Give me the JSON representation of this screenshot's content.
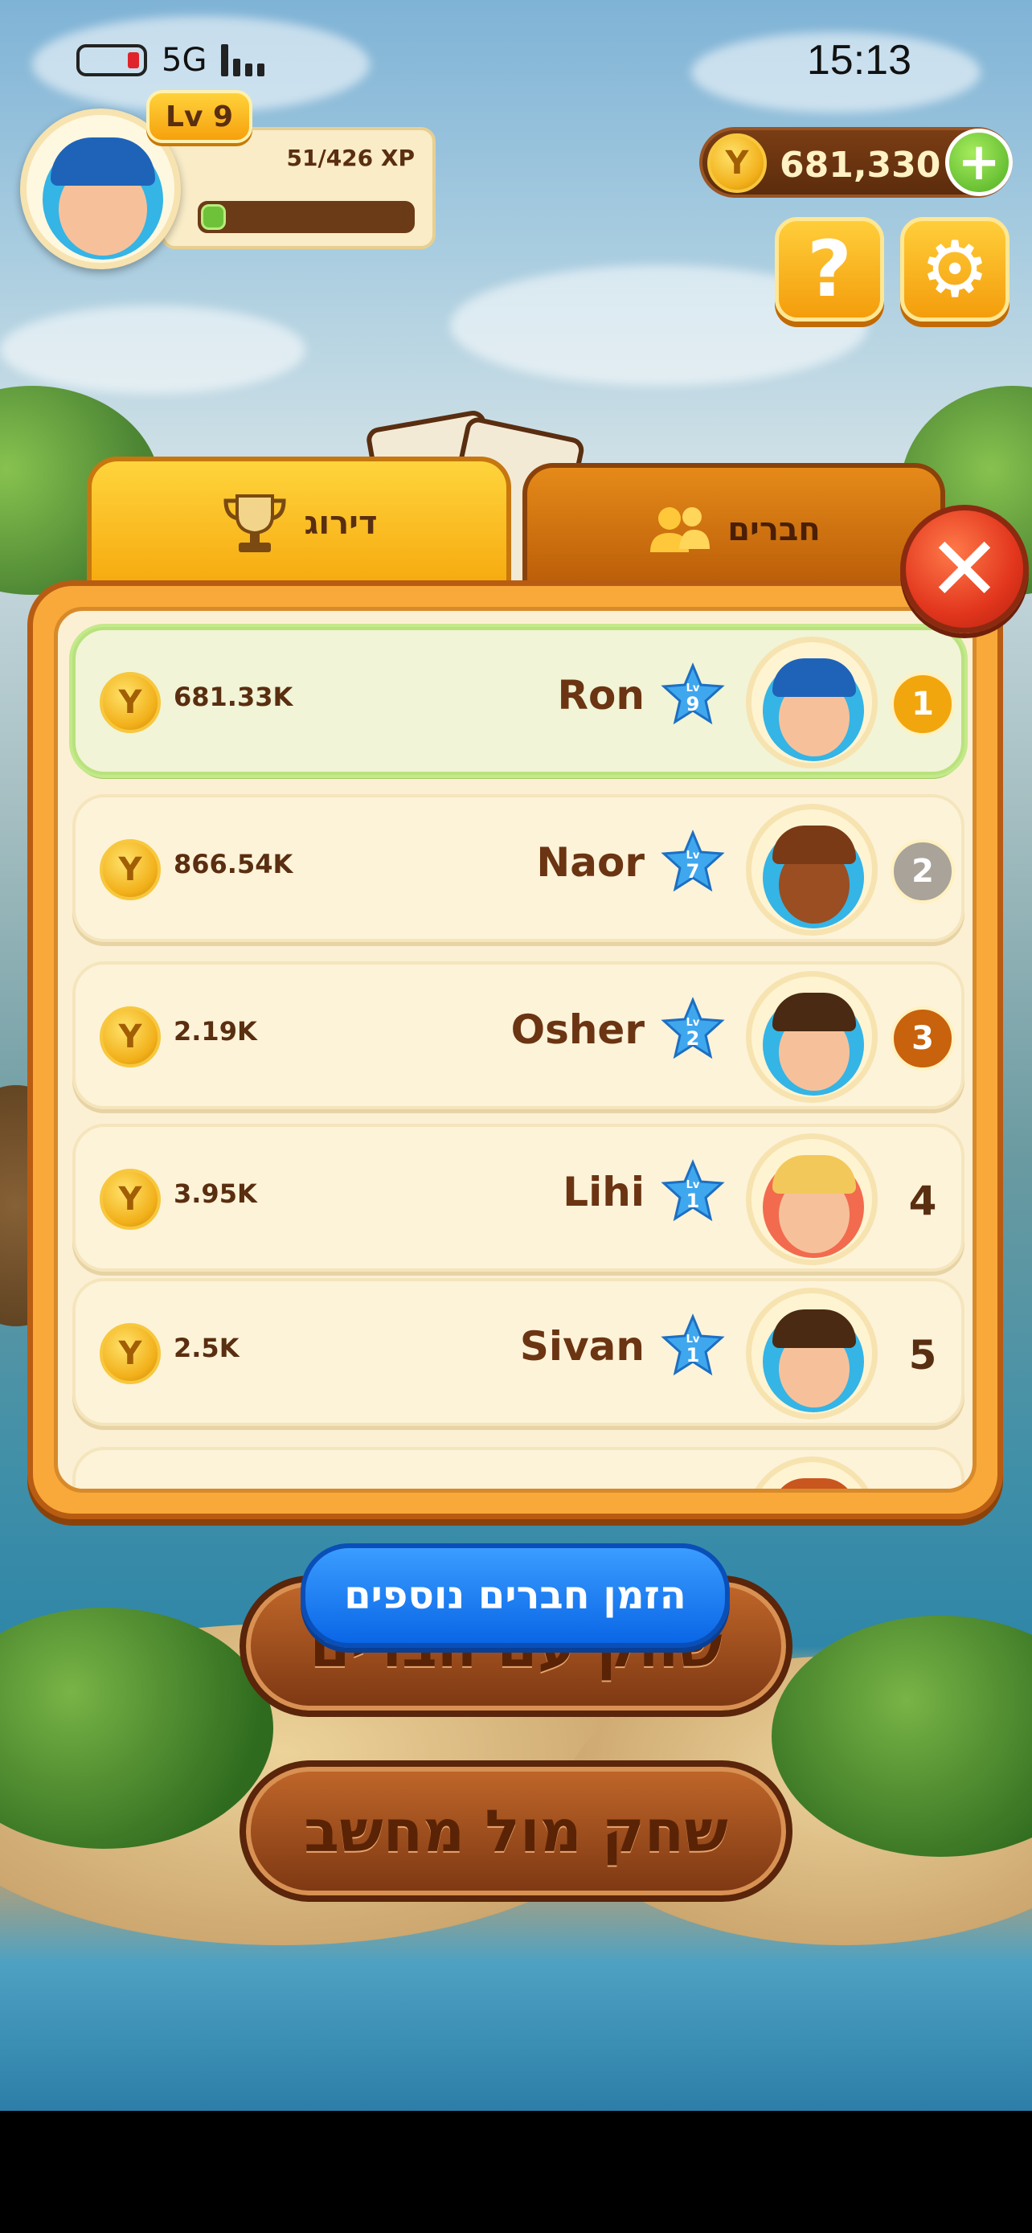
{
  "status_bar": {
    "network": "5G",
    "time": "15:13"
  },
  "profile": {
    "level_label": "Lv 9",
    "xp_text": "51/426 XP",
    "xp_progress": 0.12
  },
  "currency": {
    "coin_glyph": "Y",
    "amount": "681,330",
    "add_label": "+"
  },
  "top_buttons": {
    "help_label": "?",
    "settings_label": "⚙"
  },
  "tabs": [
    {
      "label": "דירוג",
      "icon": "trophy-icon",
      "active": true
    },
    {
      "label": "חברים",
      "icon": "friends-icon",
      "active": false
    }
  ],
  "close_label": "✕",
  "leaderboard": [
    {
      "rank": "1",
      "name": "Ron",
      "level": "9",
      "score": "681.33K",
      "avatar": "boy-cap",
      "highlight": true,
      "medal": "gold"
    },
    {
      "rank": "2",
      "name": "Naor",
      "level": "7",
      "score": "866.54K",
      "avatar": "walrus",
      "highlight": false,
      "medal": "silver"
    },
    {
      "rank": "3",
      "name": "Osher",
      "level": "2",
      "score": "2.19K",
      "avatar": "boy-glasses",
      "highlight": false,
      "medal": "bronze"
    },
    {
      "rank": "4",
      "name": "Lihi",
      "level": "1",
      "score": "3.95K",
      "avatar": "girl-blonde",
      "highlight": false,
      "medal": ""
    },
    {
      "rank": "5",
      "name": "Sivan",
      "level": "1",
      "score": "2.5K",
      "avatar": "boy-glasses",
      "highlight": false,
      "medal": ""
    }
  ],
  "level_prefix": "Lv",
  "buttons": {
    "invite": "הזמן חברים נוספים",
    "play_friends": "שחק עם חברים",
    "play_computer": "שחק מול מחשב"
  },
  "colors": {
    "accent_yellow": "#f6aa0e",
    "wood_brown": "#7c3712",
    "highlight_green": "#b9e27d",
    "invite_blue": "#0a66e6",
    "close_red": "#e2361d"
  }
}
